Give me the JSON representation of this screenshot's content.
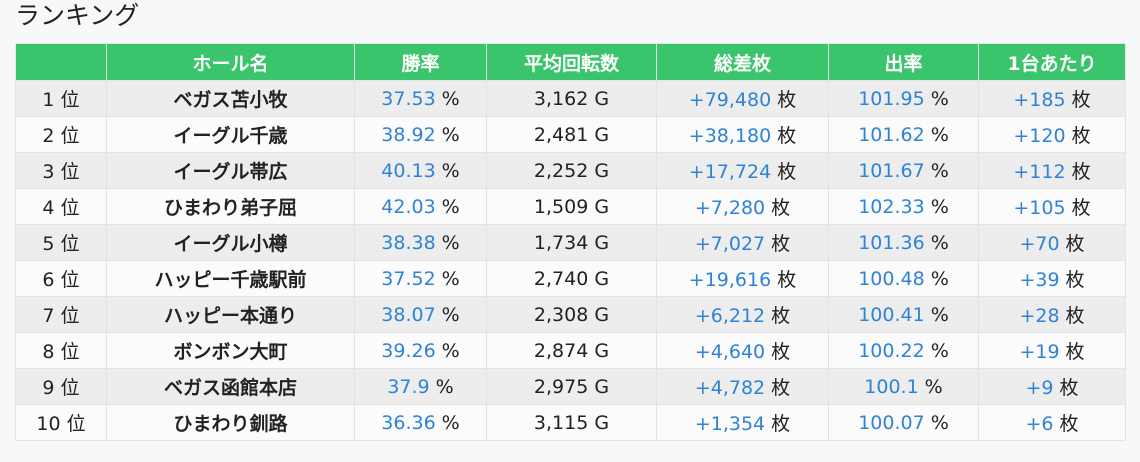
{
  "page": {
    "title": "ランキング"
  },
  "table": {
    "headers": [
      "",
      "ホール名",
      "勝率",
      "平均回転数",
      "総差枚",
      "出率",
      "1台あたり"
    ],
    "rows": [
      {
        "rank": "1 位",
        "hall": "ベガス苫小牧",
        "win_rate": "37.53",
        "win_unit": "%",
        "avg_spins": "3,162 G",
        "total_diff": "+79,480",
        "diff_unit": "枚",
        "payout": "101.95",
        "payout_unit": "%",
        "per_machine": "+185",
        "per_unit": "枚"
      },
      {
        "rank": "2 位",
        "hall": "イーグル千歳",
        "win_rate": "38.92",
        "win_unit": "%",
        "avg_spins": "2,481 G",
        "total_diff": "+38,180",
        "diff_unit": "枚",
        "payout": "101.62",
        "payout_unit": "%",
        "per_machine": "+120",
        "per_unit": "枚"
      },
      {
        "rank": "3 位",
        "hall": "イーグル帯広",
        "win_rate": "40.13",
        "win_unit": "%",
        "avg_spins": "2,252 G",
        "total_diff": "+17,724",
        "diff_unit": "枚",
        "payout": "101.67",
        "payout_unit": "%",
        "per_machine": "+112",
        "per_unit": "枚"
      },
      {
        "rank": "4 位",
        "hall": "ひまわり弟子屈",
        "win_rate": "42.03",
        "win_unit": "%",
        "avg_spins": "1,509 G",
        "total_diff": "+7,280",
        "diff_unit": "枚",
        "payout": "102.33",
        "payout_unit": "%",
        "per_machine": "+105",
        "per_unit": "枚"
      },
      {
        "rank": "5 位",
        "hall": "イーグル小樽",
        "win_rate": "38.38",
        "win_unit": "%",
        "avg_spins": "1,734 G",
        "total_diff": "+7,027",
        "diff_unit": "枚",
        "payout": "101.36",
        "payout_unit": "%",
        "per_machine": "+70",
        "per_unit": "枚"
      },
      {
        "rank": "6 位",
        "hall": "ハッピー千歳駅前",
        "win_rate": "37.52",
        "win_unit": "%",
        "avg_spins": "2,740 G",
        "total_diff": "+19,616",
        "diff_unit": "枚",
        "payout": "100.48",
        "payout_unit": "%",
        "per_machine": "+39",
        "per_unit": "枚"
      },
      {
        "rank": "7 位",
        "hall": "ハッピー本通り",
        "win_rate": "38.07",
        "win_unit": "%",
        "avg_spins": "2,308 G",
        "total_diff": "+6,212",
        "diff_unit": "枚",
        "payout": "100.41",
        "payout_unit": "%",
        "per_machine": "+28",
        "per_unit": "枚"
      },
      {
        "rank": "8 位",
        "hall": "ボンボン大町",
        "win_rate": "39.26",
        "win_unit": "%",
        "avg_spins": "2,874 G",
        "total_diff": "+4,640",
        "diff_unit": "枚",
        "payout": "100.22",
        "payout_unit": "%",
        "per_machine": "+19",
        "per_unit": "枚"
      },
      {
        "rank": "9 位",
        "hall": "ベガス函館本店",
        "win_rate": "37.9",
        "win_unit": "%",
        "avg_spins": "2,975 G",
        "total_diff": "+4,782",
        "diff_unit": "枚",
        "payout": "100.1",
        "payout_unit": "%",
        "per_machine": "+9",
        "per_unit": "枚"
      },
      {
        "rank": "10 位",
        "hall": "ひまわり釧路",
        "win_rate": "36.36",
        "win_unit": "%",
        "avg_spins": "3,115 G",
        "total_diff": "+1,354",
        "diff_unit": "枚",
        "payout": "100.07",
        "payout_unit": "%",
        "per_machine": "+6",
        "per_unit": "枚"
      }
    ]
  },
  "colors": {
    "header_bg": "#3ac46b",
    "header_text": "#ffffff",
    "value_blue": "#2f83d6",
    "row_odd": "#ededed",
    "row_even": "#fbfbfb"
  }
}
